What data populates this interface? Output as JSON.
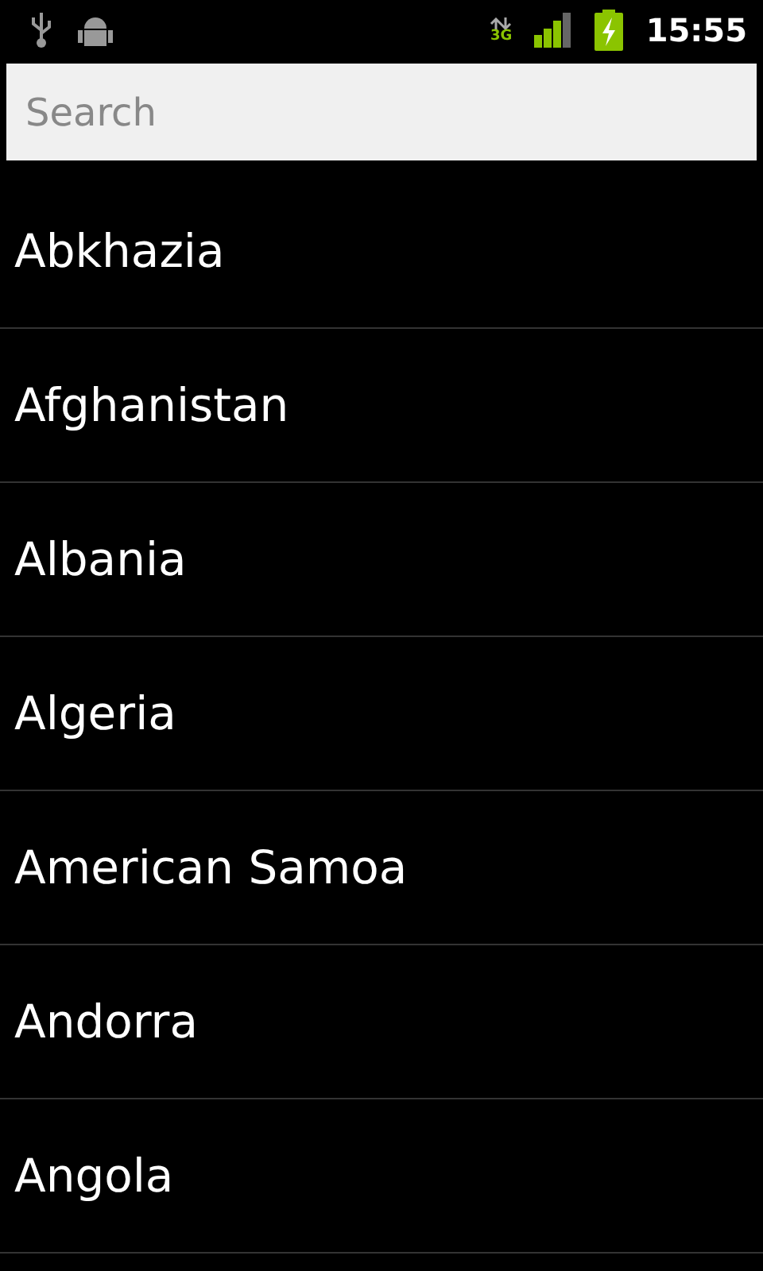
{
  "status_bar": {
    "network": "3G",
    "time": "15:55"
  },
  "search": {
    "placeholder": "Search"
  },
  "countries": [
    "Abkhazia",
    "Afghanistan",
    "Albania",
    "Algeria",
    "American Samoa",
    "Andorra",
    "Angola"
  ]
}
